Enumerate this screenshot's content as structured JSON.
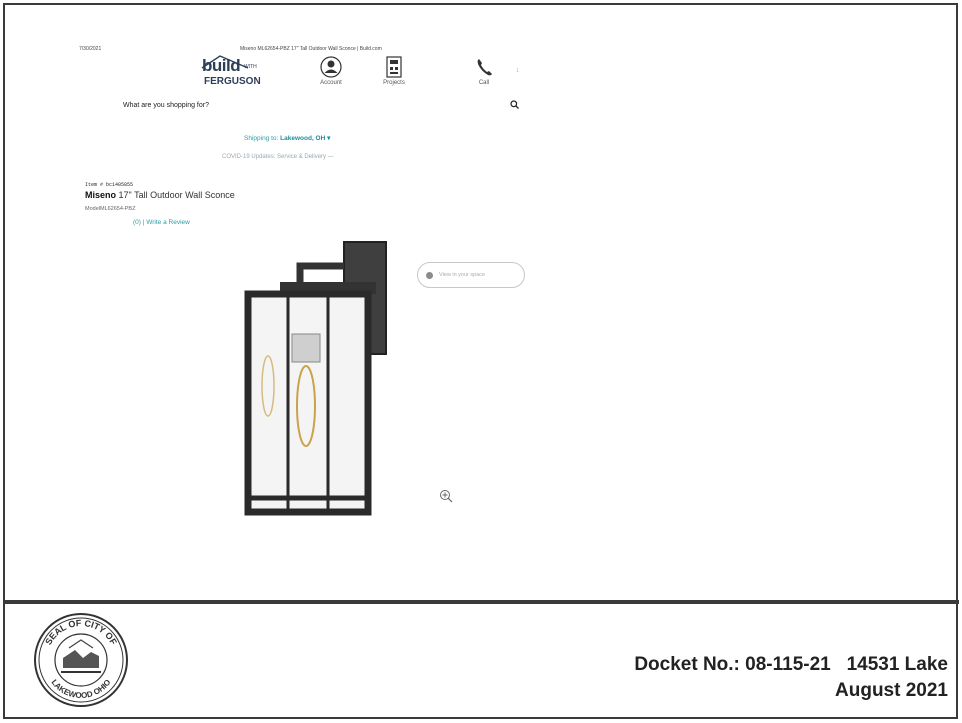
{
  "header": {
    "print_date": "7/30/2021",
    "print_title": "Miseno ML62654-PBZ 17\" Tall Outdoor Wall Sconce | Build.com",
    "page_marker": "1"
  },
  "logo": {
    "build": "build",
    "with": "WITH",
    "ferguson": "FERGUSON"
  },
  "nav": {
    "account": "Account",
    "projects": "Projects",
    "call": "Call"
  },
  "search": {
    "placeholder": "What are you shopping for?"
  },
  "shipping": {
    "label": "Shipping to:",
    "location": "Lakewood, OH ▾"
  },
  "covid": {
    "text": "COVID-19 Updates: Service & Delivery —"
  },
  "product": {
    "item_number": "Item # bc1405855",
    "brand": "Miseno",
    "title": "17\" Tall Outdoor Wall Sconce",
    "model_label": "Model",
    "model": "ML62654-PBZ",
    "review": "(0) | Write a Review"
  },
  "ar_button": {
    "label": "View in your space"
  },
  "footer": {
    "seal_text_top": "SEAL OF CITY OF",
    "seal_text_bottom": "LAKEWOOD OHIO",
    "docket": "Docket No.: 08-115-21   14531 Lake",
    "date": "August 2021"
  },
  "colors": {
    "accent": "#2aa0a5",
    "brand": "#2d3e57",
    "rule": "#3a3a3a"
  }
}
